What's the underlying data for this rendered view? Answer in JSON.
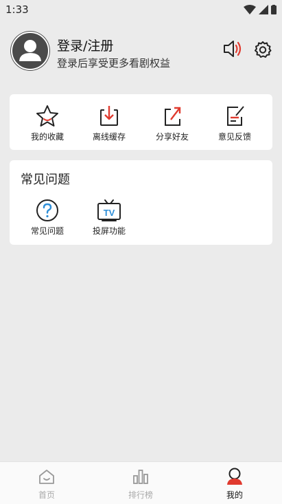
{
  "status": {
    "time": "1:33"
  },
  "profile": {
    "title": "登录/注册",
    "subtitle": "登录后享受更多看剧权益"
  },
  "quick_actions": [
    {
      "label": "我的收藏",
      "icon": "star-icon"
    },
    {
      "label": "离线缓存",
      "icon": "download-icon"
    },
    {
      "label": "分享好友",
      "icon": "share-icon"
    },
    {
      "label": "意见反馈",
      "icon": "feedback-icon"
    }
  ],
  "faq_section": {
    "title": "常见问题",
    "items": [
      {
        "label": "常见问题",
        "icon": "question-icon"
      },
      {
        "label": "投屏功能",
        "icon": "tv-cast-icon",
        "icon_text": "TV"
      }
    ]
  },
  "bottom_nav": [
    {
      "label": "首页",
      "icon": "home-icon"
    },
    {
      "label": "排行榜",
      "icon": "ranking-icon"
    },
    {
      "label": "我的",
      "icon": "profile-icon",
      "active": true
    }
  ],
  "colors": {
    "accent": "#e03a2f",
    "ink": "#222222",
    "blue": "#2f8fd8"
  }
}
